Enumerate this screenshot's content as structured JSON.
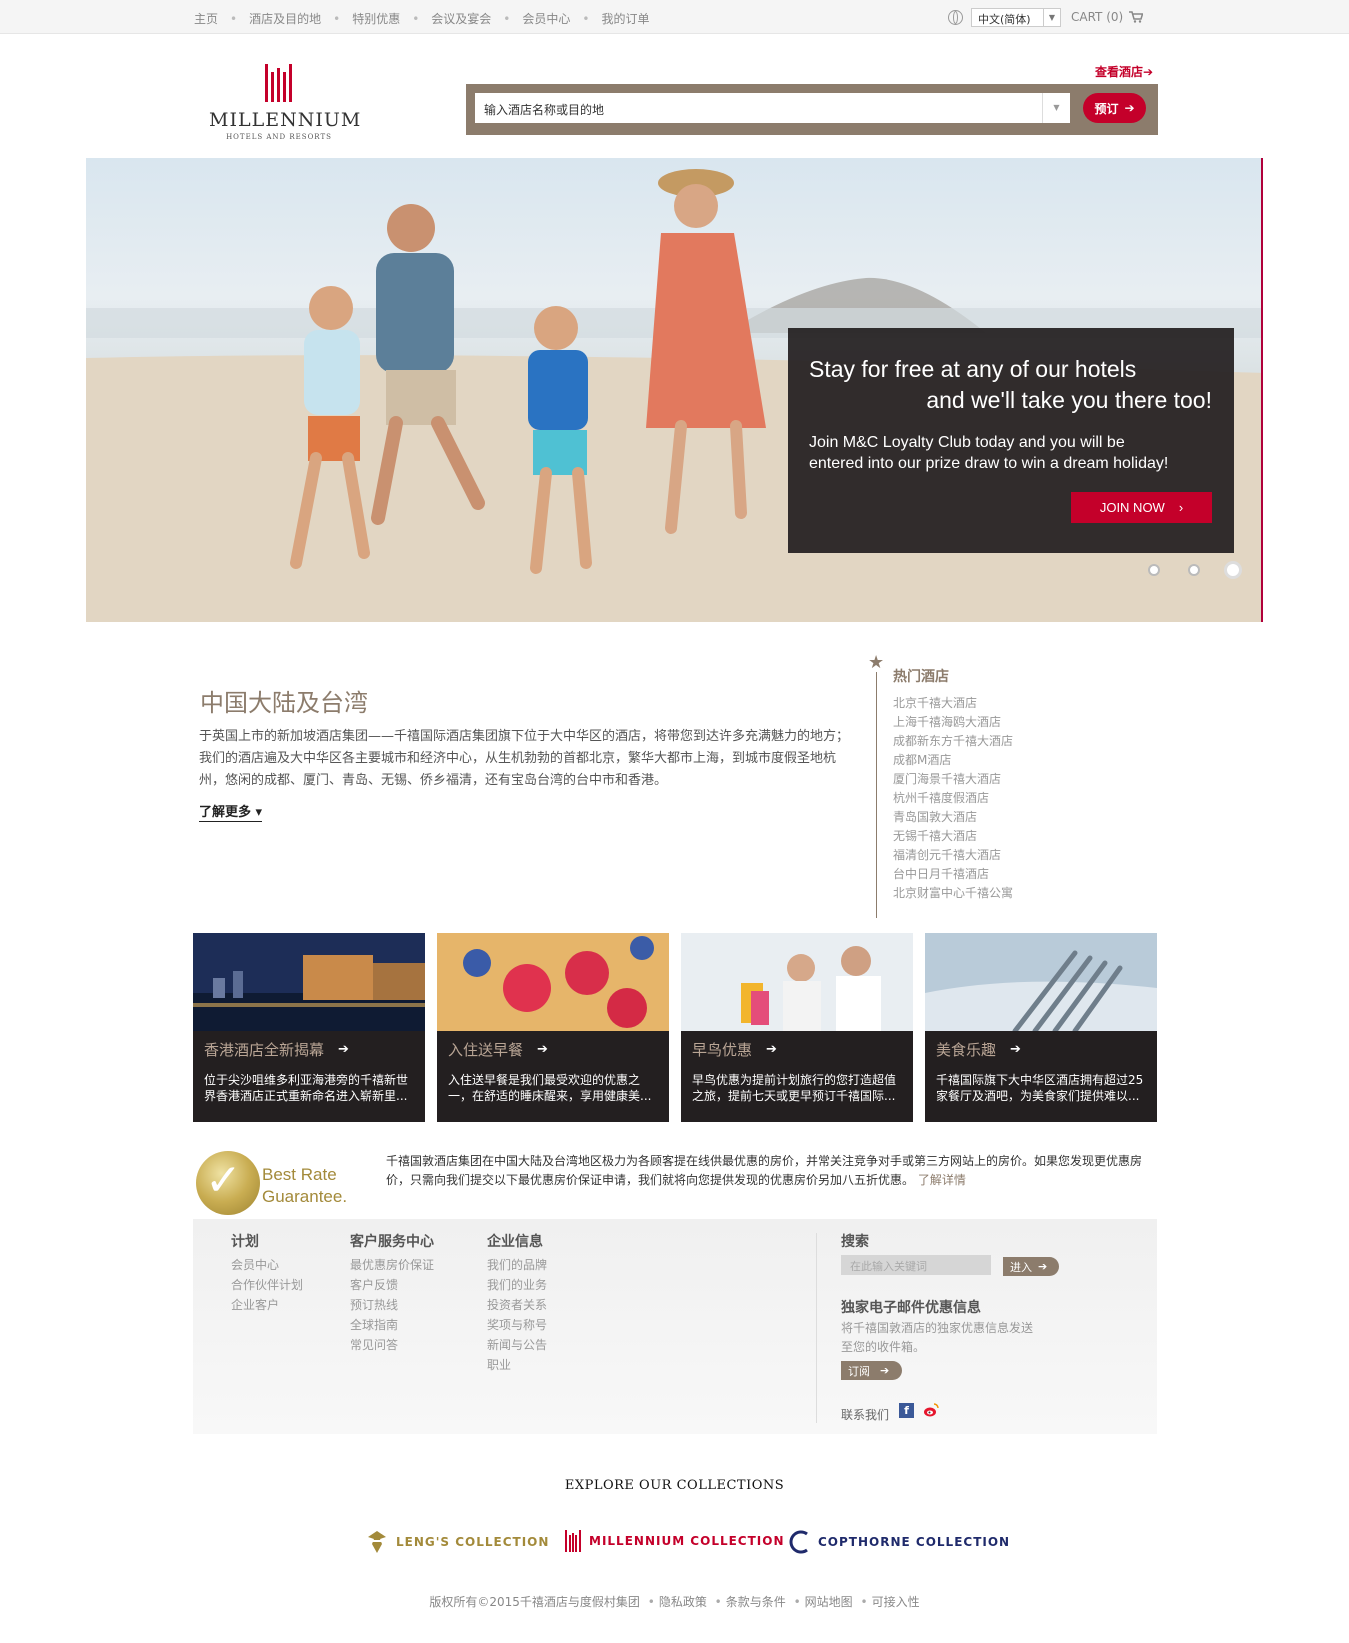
{
  "topnav": {
    "items": [
      "主页",
      "酒店及目的地",
      "特别优惠",
      "会议及宴会",
      "会员中心",
      "我的订单"
    ],
    "language": "中文(简体)",
    "cart": "CART (0)"
  },
  "header": {
    "logo_word": "MILLENNIUM",
    "logo_sub": "HOTELS AND RESORTS",
    "view_hotels": "查看酒店",
    "search_placeholder": "输入酒店名称或目的地",
    "book_label": "预订"
  },
  "hero": {
    "headline_1": "Stay for free at any of our hotels",
    "headline_2": "and we'll take you there too!",
    "body_1": "Join M&C Loyalty Club today and you will be",
    "body_2": "entered into our prize draw to win a dream holiday!",
    "cta": "JOIN NOW",
    "slides": 3,
    "active_slide": 3
  },
  "intro": {
    "title": "中国大陆及台湾",
    "body": "于英国上市的新加坡酒店集团——千禧国际酒店集团旗下位于大中华区的酒店，将带您到达许多充满魅力的地方；我们的酒店遍及大中华区各主要城市和经济中心，从生机勃勃的首都北京，繁华大都市上海，到城市度假圣地杭州，悠闲的成都、厦门、青岛、无锡、侨乡福清，还有宝岛台湾的台中市和香港。",
    "learn_more": "了解更多"
  },
  "hot_hotels": {
    "title": "热门酒店",
    "items": [
      "北京千禧大酒店",
      "上海千禧海鸥大酒店",
      "成都新东方千禧大酒店",
      "成都M酒店",
      "厦门海景千禧大酒店",
      "杭州千禧度假酒店",
      "青岛国敦大酒店",
      "无锡千禧大酒店",
      "福清创元千禧大酒店",
      "台中日月千禧酒店",
      "北京财富中心千禧公寓"
    ]
  },
  "tiles": [
    {
      "title": "香港酒店全新揭幕",
      "desc": "位于尖沙咀维多利亚海港旁的千禧新世界香港酒店正式重新命名进入崭新里..."
    },
    {
      "title": "入住送早餐",
      "desc": "入住送早餐是我们最受欢迎的优惠之一，在舒适的睡床醒来，享用健康美..."
    },
    {
      "title": "早鸟优惠",
      "desc": "早鸟优惠为提前计划旅行的您打造超值之旅，提前七天或更早预订千禧国际..."
    },
    {
      "title": "美食乐趣",
      "desc": "千禧国际旗下大中华区酒店拥有超过25家餐厅及酒吧，为美食家们提供难以..."
    }
  ],
  "best_rate": {
    "badge_line_1": "Best Rate",
    "badge_line_2": "Guarantee.",
    "text": "千禧国敦酒店集团在中国大陆及台湾地区极力为各顾客提在线供最优惠的房价，并常关注竞争对手或第三方网站上的房价。如果您发现更优惠房价，只需向我们提交以下最优惠房价保证申请，我们就将向您提供发现的优惠房价另加八五折优惠。",
    "link": "了解详情"
  },
  "footer": {
    "plans": {
      "title": "计划",
      "items": [
        "会员中心",
        "合作伙伴计划",
        "企业客户"
      ]
    },
    "service": {
      "title": "客户服务中心",
      "items": [
        "最优惠房价保证",
        "客户反馈",
        "预订热线",
        "全球指南",
        "常见问答"
      ]
    },
    "corporate": {
      "title": "企业信息",
      "items": [
        "我们的品牌",
        "我们的业务",
        "投资者关系",
        "奖项与称号",
        "新闻与公告",
        "职业"
      ]
    },
    "search_title": "搜索",
    "search_placeholder": "在此输入关键词",
    "search_btn": "进入",
    "newsletter_title": "独家电子邮件优惠信息",
    "newsletter_text": "将千禧国敦酒店的独家优惠信息发送至您的收件箱。",
    "subscribe": "订阅",
    "contact": "联系我们"
  },
  "collections": {
    "title": "EXPLORE OUR COLLECTIONS",
    "items": [
      "LENG'S COLLECTION",
      "MILLENNIUM COLLECTION",
      "COPTHORNE COLLECTION"
    ]
  },
  "copyright": {
    "text": "版权所有©2015千禧酒店与度假村集团",
    "links": [
      "隐私政策",
      "条款与条件",
      "网站地图",
      "可接入性"
    ]
  },
  "colors": {
    "brand_red": "#c4002a",
    "taupe": "#8c7c6c",
    "dark": "#231f20"
  }
}
